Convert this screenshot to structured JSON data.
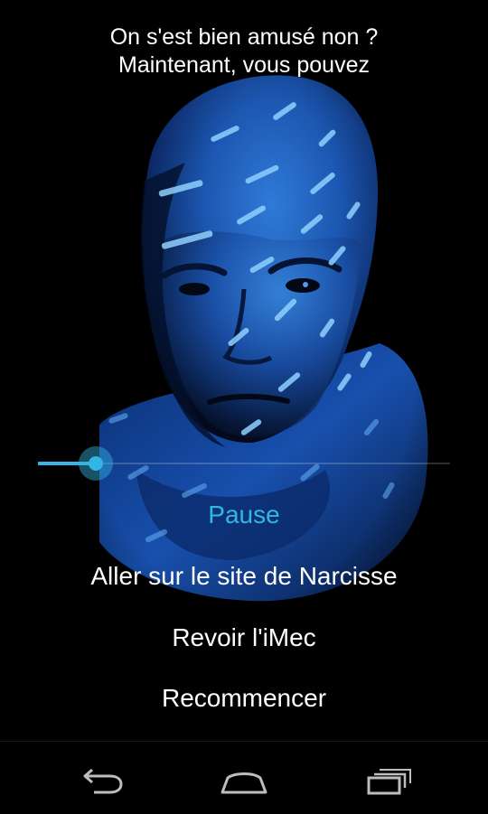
{
  "header": {
    "line1": "On s'est bien amusé non ?",
    "line2": "Maintenant, vous pouvez"
  },
  "player": {
    "progress_fraction": 0.14
  },
  "menu": {
    "pause": "Pause",
    "visit_site": "Aller sur le site de Narcisse",
    "replay": "Revoir l'iMec",
    "restart": "Recommencer"
  },
  "navbar": {
    "back_icon": "back-icon",
    "home_icon": "home-icon",
    "recent_icon": "recent-apps-icon"
  },
  "colors": {
    "accent": "#33b5e5",
    "background": "#000000",
    "text": "#ffffff"
  }
}
